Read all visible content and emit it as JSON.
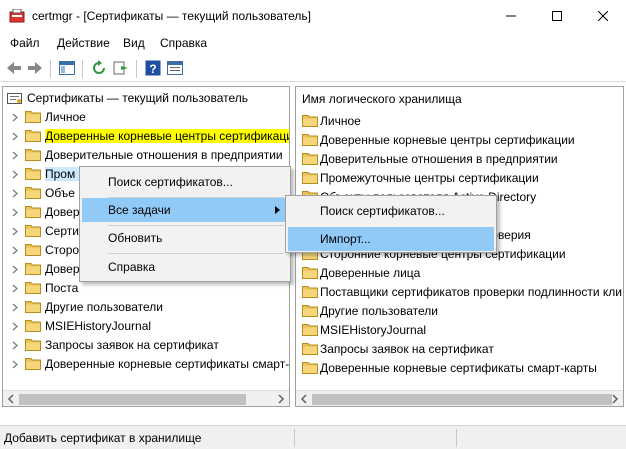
{
  "window": {
    "title": "certmgr - [Сертификаты — текущий пользователь]",
    "icons": {
      "app": "certificate-app-icon",
      "minimize": "minimize-icon",
      "maximize": "maximize-icon",
      "close": "close-icon"
    }
  },
  "menubar": {
    "file": "Файл",
    "action": "Действие",
    "view": "Вид",
    "help": "Справка"
  },
  "toolbar": {
    "icons": [
      "back-arrow-icon",
      "forward-arrow-icon",
      "show-hide-console-tree-icon",
      "refresh-icon",
      "export-list-icon",
      "help-icon",
      "properties-icon"
    ]
  },
  "tree": {
    "root": "Сертификаты — текущий пользователь",
    "items": [
      {
        "label": "Личное"
      },
      {
        "label": "Доверенные корневые центры сертификаци"
      },
      {
        "label": "Доверительные отношения в предприятии"
      },
      {
        "label": "Пром"
      },
      {
        "label": "Объе"
      },
      {
        "label": "Довер"
      },
      {
        "label": "Серти"
      },
      {
        "label": "Сторо"
      },
      {
        "label": "Довер"
      },
      {
        "label": "Поста"
      },
      {
        "label": "Другие пользователи"
      },
      {
        "label": "MSIEHistoryJournal"
      },
      {
        "label": "Запросы заявок на сертификат"
      },
      {
        "label": "Доверенные корневые сертификаты смарт-"
      }
    ]
  },
  "list": {
    "header": "Имя логического хранилища",
    "rows": [
      {
        "label": "Личное"
      },
      {
        "label": "Доверенные корневые центры сертификации"
      },
      {
        "label": "Доверительные отношения в предприятии"
      },
      {
        "label": "Промежуточные центры сертификации"
      },
      {
        "label": "Объекты пользователя Active Directory"
      },
      {
        "label": "Доверенные издатели"
      },
      {
        "label": "Сертификаты, к которым нет доверия"
      },
      {
        "label": "Сторонние корневые центры сертификации"
      },
      {
        "label": "Доверенные лица"
      },
      {
        "label": "Поставщики сертификатов проверки подлинности кли"
      },
      {
        "label": "Другие пользователи"
      },
      {
        "label": "MSIEHistoryJournal"
      },
      {
        "label": "Запросы заявок на сертификат"
      },
      {
        "label": "Доверенные корневые сертификаты смарт-карты"
      }
    ]
  },
  "context_menu": {
    "find": "Поиск сертификатов...",
    "all_tasks": "Все задачи",
    "refresh": "Обновить",
    "help": "Справка"
  },
  "submenu": {
    "find": "Поиск сертификатов...",
    "import": "Импорт..."
  },
  "status": {
    "text": "Добавить сертификат в хранилище"
  },
  "colors": {
    "highlight_yellow": "#ffff00",
    "menu_hot": "#91c9f7",
    "folder": "#e8c255"
  }
}
